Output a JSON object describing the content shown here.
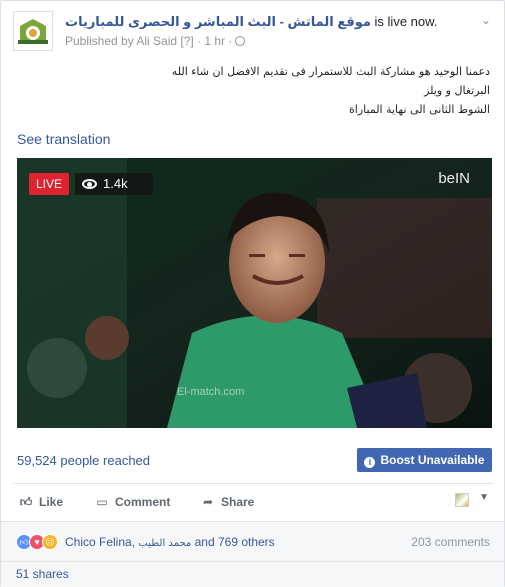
{
  "header": {
    "page_name": "موقع الماتش - البث المباشر و الحصرى للمباريات",
    "status": "is live now.",
    "meta": "Published by Ali Said [?] · 1 hr ·"
  },
  "post": {
    "lines": [
      "دعمنا الوحيد هو مشاركة البث للاستمرار فى تقديم الافضل ان شاء الله",
      "البرتغال و ويلز",
      "الشوط الثانى الى نهاية المباراة"
    ],
    "see_translation": "See translation"
  },
  "video": {
    "live_label": "LIVE",
    "viewers": "1.4k",
    "channel_logo": "beIN",
    "watermark": "El-match.com"
  },
  "stats": {
    "reached": "59,524 people reached",
    "boost_label": "Boost Unavailable"
  },
  "actions": {
    "like": "Like",
    "comment": "Comment",
    "share": "Share"
  },
  "reactions": {
    "names_prefix": "Chico Felina,",
    "names_arabic": "محمد الطيب",
    "names_suffix": "and 769 others",
    "comments": "203 comments"
  },
  "shares": "51 shares",
  "icons": [
    "chevron-down-icon",
    "globe-icon",
    "eye-icon",
    "info-icon",
    "like-icon",
    "comment-icon",
    "share-icon",
    "like-reaction-icon",
    "love-reaction-icon",
    "angry-reaction-icon"
  ],
  "colors": {
    "link": "#365899",
    "live": "#e0242f",
    "boost": "#4267b2"
  }
}
